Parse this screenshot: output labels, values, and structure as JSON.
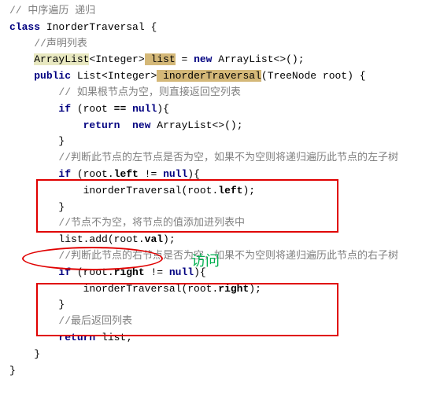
{
  "line1": {
    "comment": "// 中序遍历 递归"
  },
  "line2": {
    "kw_class": "class",
    "name": "InorderTraversal",
    "brace": " {"
  },
  "line3": {
    "comment": "//声明列表"
  },
  "line4": {
    "type1": "ArrayList",
    "g1": "<Integer>",
    "var": " list",
    "eq": " = ",
    "kw_new": "new ",
    "type2": "ArrayList",
    "g2": "<>();"
  },
  "line5": {
    "kw_public": "public",
    "type1": " List",
    "g1": "<Integer>",
    "method": " inorderTraversal",
    "params": "(TreeNode root) {"
  },
  "line6": {
    "comment": "// 如果根节点为空，则直接返回空列表"
  },
  "line7": {
    "kw_if": "if",
    "rest1": " (root ",
    "eq_op": "==",
    "rest2": " ",
    "kw_null": "null",
    "rest3": "){"
  },
  "line8": {
    "kw_return": "return",
    "sp": "  ",
    "kw_new": "new ",
    "type": "ArrayList",
    "rest": "<>();"
  },
  "line9": {
    "brace": "}"
  },
  "line10": {
    "comment": "//判断此节点的左节点是否为空，如果不为空则将递归遍历此节点的左子树"
  },
  "line11": {
    "kw_if": "if",
    "r1": " (root.",
    "field": "left",
    "r2": " != ",
    "kw_null": "null",
    "r3": "){"
  },
  "line12": {
    "call": "inorderTraversal(root.",
    "field": "left",
    "r2": ");"
  },
  "line13": {
    "brace": "}"
  },
  "line14": {
    "comment": "//节点不为空，将节点的值添加进列表中"
  },
  "line15": {
    "call1": "list.add(root.",
    "field": "val",
    "r2": ");"
  },
  "line16": {
    "comment": "//判断此节点的右节点是否为空，如果不为空则将递归遍历此节点的右子树"
  },
  "line17": {
    "kw_if": "if",
    "r1": " (root.",
    "field": "right",
    "r2": " != ",
    "kw_null": "null",
    "r3": "){"
  },
  "line18": {
    "call": "inorderTraversal(root.",
    "field": "right",
    "r2": ");"
  },
  "line19": {
    "brace": "}"
  },
  "line20": {
    "comment": "//最后返回列表"
  },
  "line21": {
    "kw_return": "return",
    "r1": " list;"
  },
  "line22": {
    "brace": "}"
  },
  "line23": {
    "brace": "}"
  },
  "green_label": "访问"
}
